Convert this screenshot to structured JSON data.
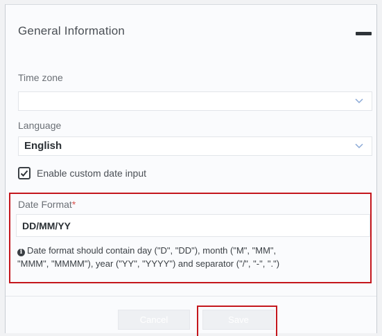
{
  "section": {
    "title": "General Information"
  },
  "fields": {
    "timezone": {
      "label": "Time zone",
      "value": ""
    },
    "language": {
      "label": "Language",
      "value": "English"
    },
    "custom_date": {
      "label": "Enable custom date input",
      "checked": true
    },
    "date_format": {
      "label": "Date Format",
      "required_marker": "*",
      "value": "DD/MM/YY",
      "help_line1": "Date format should contain day (\"D\", \"DD\"), month (\"M\", \"MM\",",
      "help_line2": "\"MMM\", \"MMMM\"), year (\"YY\", \"YYYY\") and separator (\"/\", \"-\", \".\")"
    }
  },
  "actions": {
    "cancel_label": "Cancel",
    "save_label": "Save"
  },
  "colors": {
    "highlight": "#c4161c",
    "required": "#d9534f",
    "chevron": "#8aa9d6"
  },
  "icons": {
    "collapse": "minus-icon",
    "dropdown": "chevron-down-icon",
    "checkbox": "checkmark-icon",
    "info": "info-circle-icon"
  }
}
